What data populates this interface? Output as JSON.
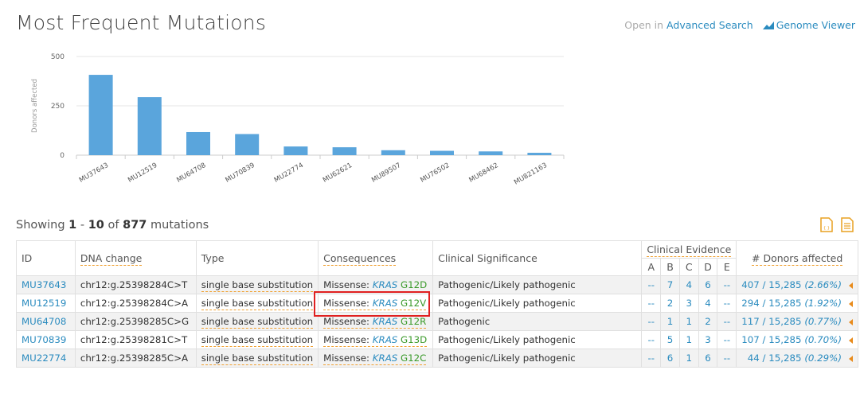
{
  "header": {
    "title": "Most Frequent Mutations",
    "open_in_prefix": "Open in",
    "advanced_search": "Advanced Search",
    "genome_viewer": "Genome Viewer"
  },
  "chart_data": {
    "type": "bar",
    "ylabel": "Donors affected",
    "ylim": [
      0,
      500
    ],
    "yticks": [
      "0",
      "250",
      "500"
    ],
    "categories": [
      "MU37643",
      "MU12519",
      "MU64708",
      "MU70839",
      "MU22774",
      "MU62621",
      "MU89507",
      "MU76502",
      "MU68462",
      "MU821163"
    ],
    "values": [
      407,
      294,
      117,
      107,
      44,
      40,
      25,
      22,
      19,
      12
    ],
    "colors": {
      "bar": "#5aa5dc",
      "grid": "#e6e6e6",
      "axis": "#cccccc"
    }
  },
  "listing": {
    "showing": "Showing",
    "from": "1",
    "sep": "-",
    "to": "10",
    "of": "of",
    "total": "877",
    "unit": "mutations"
  },
  "table": {
    "headers": {
      "id": "ID",
      "dna": "DNA change",
      "type": "Type",
      "consequences": "Consequences",
      "clinical": "Clinical Significance",
      "evidence": "Clinical Evidence",
      "letters": [
        "A",
        "B",
        "C",
        "D",
        "E"
      ],
      "donors": "# Donors affected"
    },
    "rows": [
      {
        "id": "MU37643",
        "dna": "chr12:g.25398284C>T",
        "type": "single base substitution",
        "cons": "Missense:",
        "gene": "KRAS",
        "aa": "G12D",
        "clin": "Pathogenic/Likely pathogenic",
        "ev": [
          "--",
          "7",
          "4",
          "6",
          "--"
        ],
        "donors": "407 / 15,285",
        "pct": "(2.66%)"
      },
      {
        "id": "MU12519",
        "dna": "chr12:g.25398284C>A",
        "type": "single base substitution",
        "cons": "Missense:",
        "gene": "KRAS",
        "aa": "G12V",
        "clin": "Pathogenic/Likely pathogenic",
        "ev": [
          "--",
          "2",
          "3",
          "4",
          "--"
        ],
        "donors": "294 / 15,285",
        "pct": "(1.92%)"
      },
      {
        "id": "MU64708",
        "dna": "chr12:g.25398285C>G",
        "type": "single base substitution",
        "cons": "Missense:",
        "gene": "KRAS",
        "aa": "G12R",
        "clin": "Pathogenic",
        "ev": [
          "--",
          "1",
          "1",
          "2",
          "--"
        ],
        "donors": "117 / 15,285",
        "pct": "(0.77%)"
      },
      {
        "id": "MU70839",
        "dna": "chr12:g.25398281C>T",
        "type": "single base substitution",
        "cons": "Missense:",
        "gene": "KRAS",
        "aa": "G13D",
        "clin": "Pathogenic/Likely pathogenic",
        "ev": [
          "--",
          "5",
          "1",
          "3",
          "--"
        ],
        "donors": "107 / 15,285",
        "pct": "(0.70%)"
      },
      {
        "id": "MU22774",
        "dna": "chr12:g.25398285C>A",
        "type": "single base substitution",
        "cons": "Missense:",
        "gene": "KRAS",
        "aa": "G12C",
        "clin": "Pathogenic/Likely pathogenic",
        "ev": [
          "--",
          "6",
          "1",
          "6",
          "--"
        ],
        "donors": "44 / 15,285",
        "pct": "(0.29%)"
      }
    ]
  }
}
